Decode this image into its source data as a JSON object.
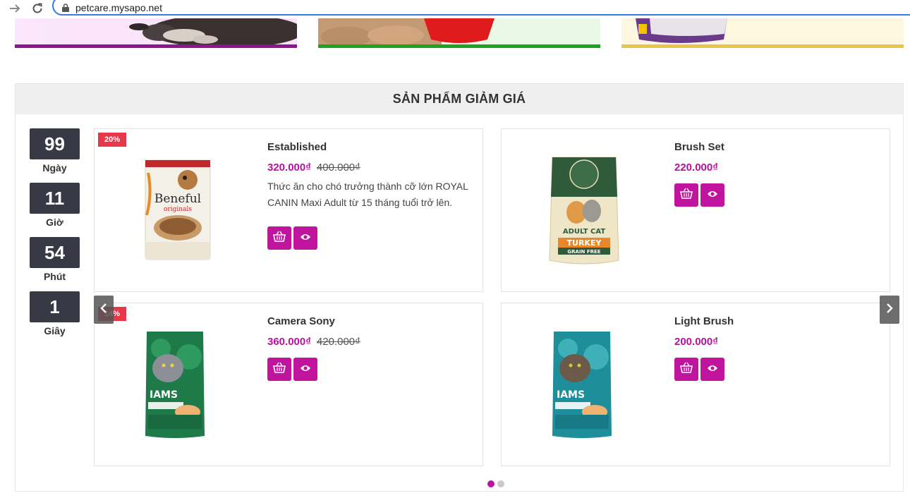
{
  "browser": {
    "url": "petcare.mysapo.net"
  },
  "section": {
    "title": "SẢN PHẨM GIẢM GIÁ"
  },
  "countdown": [
    {
      "value": "99",
      "label": "Ngày"
    },
    {
      "value": "11",
      "label": "Giờ"
    },
    {
      "value": "54",
      "label": "Phút"
    },
    {
      "value": "1",
      "label": "Giây"
    }
  ],
  "products": [
    {
      "badge": "20%",
      "name": "Established",
      "price": "320.000₫",
      "old_price": "400.000₫",
      "description": "Thức ăn cho chó trưởng thành cỡ lớn ROYAL CANIN  Maxi Adult từ 15 tháng tuổi trở lên."
    },
    {
      "name": "Brush Set",
      "price": "220.000₫"
    },
    {
      "badge": "14%",
      "name": "Camera Sony",
      "price": "360.000₫",
      "old_price": "420.000₫"
    },
    {
      "name": "Light Brush",
      "price": "200.000₫"
    }
  ],
  "colors": {
    "accent": "#c0149f",
    "price": "#b8109e",
    "badge": "#e8374a",
    "countdown_bg": "#373a45"
  },
  "icons": {
    "add_to_cart": "basket-icon",
    "quick_view": "eye-icon",
    "prev": "chevron-left-icon",
    "next": "chevron-right-icon"
  },
  "carousel": {
    "active_page": 1,
    "page_count": 2
  }
}
